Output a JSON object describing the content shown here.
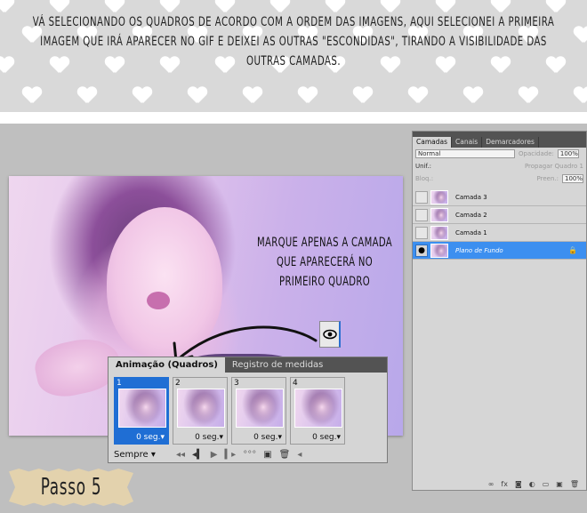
{
  "banner": {
    "text": "Vá selecionando os quadros de acordo com a ordem das imagens, aqui selecionei a primeira imagem que irá aparecer no GIF e deixei as outras \"escondidas\", tirando a visibilidade das outras camadas."
  },
  "annotation": {
    "text": "Marque apenas a camada que aparecerá no primeiro quadro"
  },
  "animation_panel": {
    "tabs": [
      "Animação (Quadros)",
      "Registro de medidas"
    ],
    "frames": [
      {
        "number": "1",
        "delay": "0 seg.",
        "arrow": "▾"
      },
      {
        "number": "2",
        "delay": "0 seg.",
        "arrow": "▾"
      },
      {
        "number": "3",
        "delay": "0 seg.",
        "arrow": "▾"
      },
      {
        "number": "4",
        "delay": "0 seg.",
        "arrow": "▾"
      }
    ],
    "loop": "Sempre",
    "loop_arrow": "▾",
    "controls": [
      "◂◂",
      "◂▍",
      "▶",
      "▍▸",
      "°°°",
      "▣",
      "🗑",
      "◂"
    ]
  },
  "layers_panel": {
    "tabs": [
      "Camadas",
      "Canais",
      "Demarcadores"
    ],
    "blend_mode": "Normal",
    "opacity_label": "Opacidade:",
    "opacity_value": "100%",
    "unify_label": "Unif.:",
    "propagate_label": "Propagar Quadro 1",
    "lock_label": "Bloq.:",
    "fill_label": "Preen.:",
    "fill_value": "100%",
    "layers": [
      {
        "name": "Camada 3",
        "visible": false
      },
      {
        "name": "Camada 2",
        "visible": false
      },
      {
        "name": "Camada 1",
        "visible": false
      },
      {
        "name": "Plano de Fundo",
        "visible": true,
        "selected": true,
        "locked": true
      }
    ],
    "footer_icons": [
      "∞",
      "fx",
      "◙",
      "◐",
      "▭",
      "▣",
      "🗑"
    ]
  },
  "step_label": {
    "text": "Passo 5"
  },
  "colors": {
    "selection_blue": "#1f6ed4",
    "layer_selected": "#3c8ff0",
    "panel_dark": "#535353",
    "stage_gray": "#bfbfbf",
    "banner_gray": "#d9d9d9",
    "tag_beige": "#e3d2ad"
  }
}
